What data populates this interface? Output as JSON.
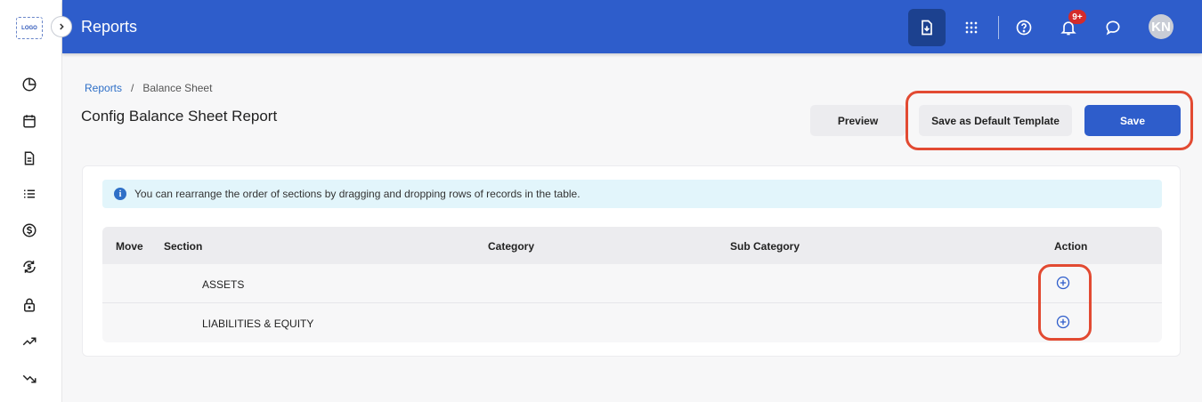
{
  "sidebar": {
    "logo": "LOGO",
    "icons": [
      "pie-chart-icon",
      "calendar-icon",
      "document-icon",
      "list-icon",
      "dollar-icon",
      "currency-exchange-icon",
      "lock-icon",
      "trending-up-icon",
      "trending-down-icon"
    ]
  },
  "header": {
    "title": "Reports",
    "notification_badge": "9+",
    "avatar_initials": "KN",
    "accent_color": "#2e5dcb"
  },
  "breadcrumb": {
    "parent": "Reports",
    "separator": "/",
    "current": "Balance Sheet"
  },
  "page": {
    "title": "Config Balance Sheet Report"
  },
  "actions": {
    "preview": "Preview",
    "save_default": "Save as Default Template",
    "save": "Save"
  },
  "info": {
    "message": "You can rearrange the order of sections by dragging and dropping rows of records in the table."
  },
  "table": {
    "columns": {
      "move": "Move",
      "section": "Section",
      "category": "Category",
      "sub_category": "Sub Category",
      "action": "Action"
    },
    "rows": [
      {
        "section": "ASSETS"
      },
      {
        "section": "LIABILITIES & EQUITY"
      }
    ]
  },
  "annotation_color": "#e24a32"
}
